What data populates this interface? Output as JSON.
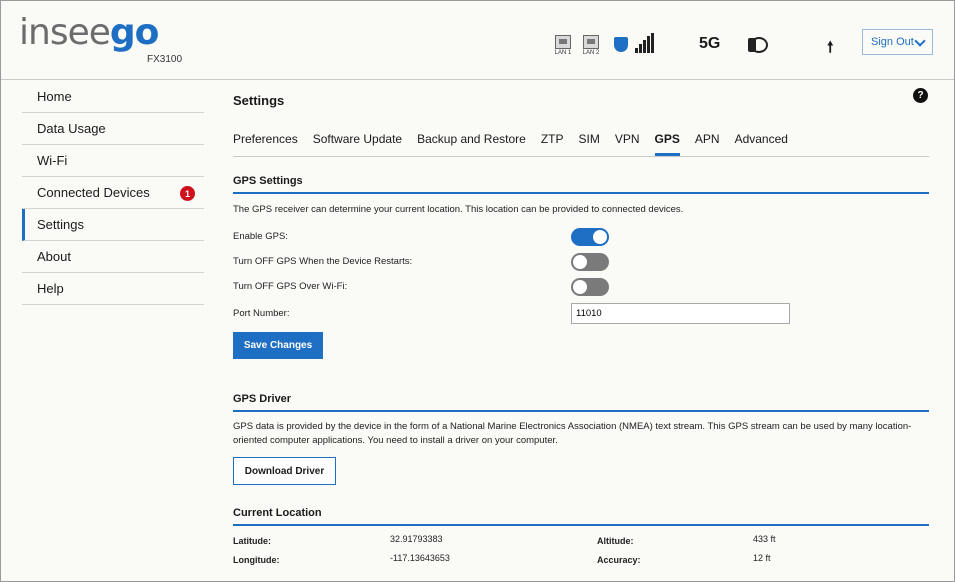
{
  "brand": {
    "logo_part1": "insee",
    "logo_part2": "go",
    "model": "FX3100"
  },
  "status_bar": {
    "lan1_label": "LAN 1",
    "lan2_label": "LAN 2",
    "network_type": "5G",
    "icons": [
      "lan-port-icon",
      "lan-port-icon",
      "security-shield-icon",
      "signal-bars-icon",
      "sim-status-icon",
      "upload-arrow-icon"
    ],
    "sign_out_label": "Sign Out"
  },
  "sidebar": {
    "items": [
      {
        "label": "Home"
      },
      {
        "label": "Data Usage"
      },
      {
        "label": "Wi-Fi"
      },
      {
        "label": "Connected Devices",
        "badge": "1"
      },
      {
        "label": "Settings",
        "active": true
      },
      {
        "label": "About"
      },
      {
        "label": "Help"
      }
    ]
  },
  "main": {
    "title": "Settings",
    "help_label": "?",
    "tabs": [
      "Preferences",
      "Software Update",
      "Backup and Restore",
      "ZTP",
      "SIM",
      "VPN",
      "GPS",
      "APN",
      "Advanced"
    ],
    "active_tab": "GPS",
    "gps_settings": {
      "title": "GPS Settings",
      "description": "The GPS receiver can determine your current location. This location can be provided to connected devices.",
      "enable_gps_label": "Enable GPS:",
      "enable_gps": true,
      "turn_off_restart_label": "Turn OFF GPS When the Device Restarts:",
      "turn_off_restart": false,
      "turn_off_wifi_label": "Turn OFF GPS Over Wi-Fi:",
      "turn_off_wifi": false,
      "port_label": "Port Number:",
      "port_value": "11010",
      "save_label": "Save Changes"
    },
    "gps_driver": {
      "title": "GPS Driver",
      "description": "GPS data is provided by the device in the form of a National Marine Electronics Association (NMEA) text stream. This GPS stream can be used by many location-oriented computer applications. You need to install a driver on your computer.",
      "download_label": "Download Driver"
    },
    "current_location": {
      "title": "Current Location",
      "latitude_label": "Latitude:",
      "latitude": "32.91793383",
      "longitude_label": "Longitude:",
      "longitude": "-117.13643653",
      "altitude_label": "Altitude:",
      "altitude": "433 ft",
      "accuracy_label": "Accuracy:",
      "accuracy": "12 ft"
    }
  },
  "colors": {
    "accent": "#1e6fc3",
    "badge": "#d0111b",
    "toggle_off": "#7a7a7a"
  }
}
